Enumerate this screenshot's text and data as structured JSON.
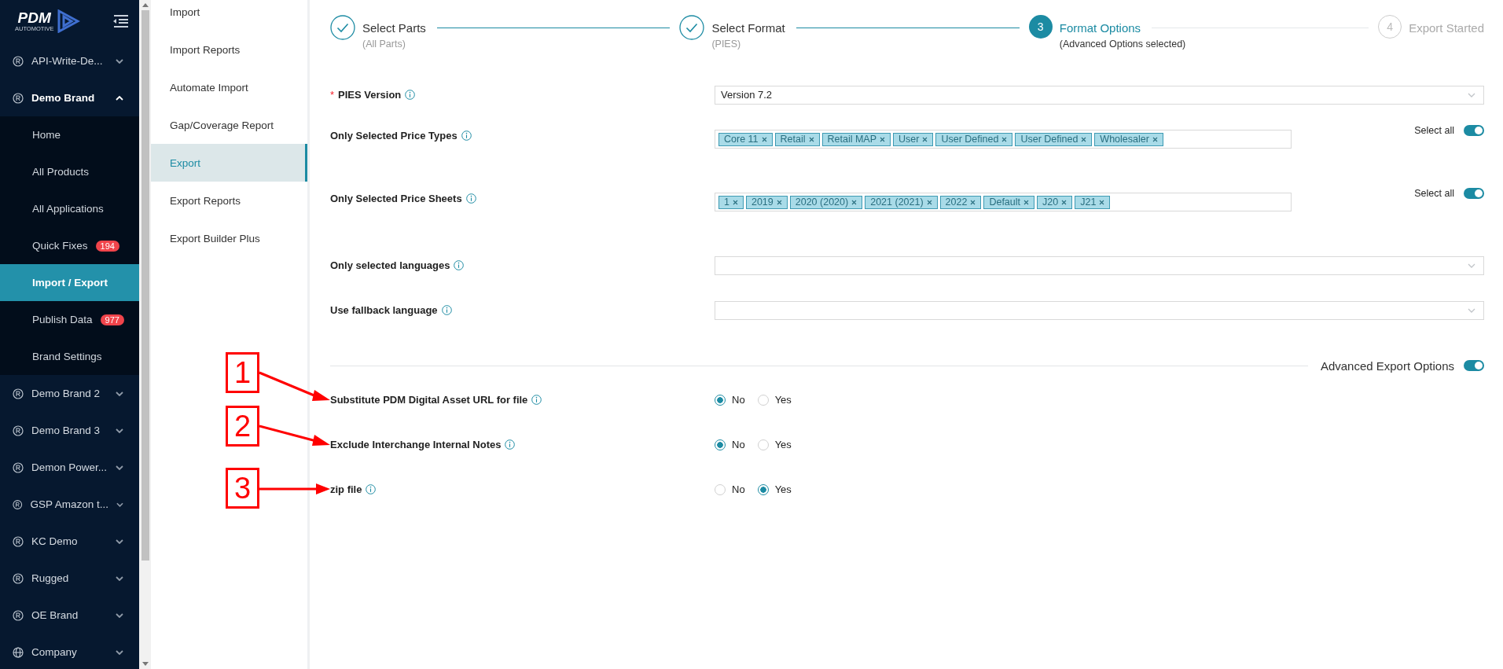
{
  "logo": {
    "name": "PDM",
    "tagline": "AUTOMOTIVE"
  },
  "sidebar": {
    "items": [
      {
        "kind": "brand",
        "label": "API-Write-De...",
        "expanded": false
      },
      {
        "kind": "brand",
        "label": "Demo Brand",
        "expanded": true,
        "children": [
          {
            "label": "Home",
            "selected": false
          },
          {
            "label": "All Products",
            "selected": false
          },
          {
            "label": "All Applications",
            "selected": false
          },
          {
            "label": "Quick Fixes",
            "selected": false,
            "badge": "194"
          },
          {
            "label": "Import / Export",
            "selected": true
          },
          {
            "label": "Publish Data",
            "selected": false,
            "badge": "977"
          },
          {
            "label": "Brand Settings",
            "selected": false
          }
        ]
      },
      {
        "kind": "brand",
        "label": "Demo Brand 2",
        "expanded": false
      },
      {
        "kind": "brand",
        "label": "Demo Brand 3",
        "expanded": false
      },
      {
        "kind": "brand",
        "label": "Demon Power...",
        "expanded": false
      },
      {
        "kind": "brand",
        "label": "GSP Amazon t...",
        "expanded": false
      },
      {
        "kind": "brand",
        "label": "KC Demo",
        "expanded": false
      },
      {
        "kind": "brand",
        "label": "Rugged",
        "expanded": false
      },
      {
        "kind": "brand",
        "label": "OE Brand",
        "expanded": false
      },
      {
        "kind": "company",
        "label": "Company",
        "expanded": false
      }
    ]
  },
  "submenu": [
    {
      "label": "Import",
      "selected": false
    },
    {
      "label": "Import Reports",
      "selected": false
    },
    {
      "label": "Automate Import",
      "selected": false
    },
    {
      "label": "Gap/Coverage Report",
      "selected": false
    },
    {
      "label": "Export",
      "selected": true
    },
    {
      "label": "Export Reports",
      "selected": false
    },
    {
      "label": "Export Builder Plus",
      "selected": false
    }
  ],
  "steps": [
    {
      "title": "Select Parts",
      "description": "(All Parts)",
      "completed": true,
      "current": false
    },
    {
      "title": "Select Format",
      "description": "(PIES)",
      "completed": true,
      "current": false
    },
    {
      "number": "3",
      "title": "Format Options",
      "description": "(Advanced Options selected)",
      "completed": false,
      "current": true
    },
    {
      "number": "4",
      "title": "Export Started",
      "completed": false,
      "current": false
    }
  ],
  "form": [
    {
      "kind": "select",
      "label": "PIES Version",
      "required_mark": "*",
      "value": "Version 7.2"
    },
    {
      "kind": "tags",
      "label": "Only Selected Price Types",
      "tags": [
        "Core 11",
        "Retail",
        "Retail MAP",
        "User",
        "User Defined",
        "User Defined",
        "Wholesaler"
      ],
      "select_all": {
        "label": "Select all",
        "on": true
      }
    },
    {
      "kind": "tags",
      "label": "Only Selected Price Sheets",
      "tags": [
        "1",
        "2019",
        "2020 (2020)",
        "2021 (2021)",
        "2022",
        "Default",
        "J20",
        "J21"
      ],
      "select_all": {
        "label": "Select all",
        "on": true
      }
    },
    {
      "kind": "select",
      "label": "Only selected languages"
    },
    {
      "kind": "select",
      "label": "Use fallback language"
    }
  ],
  "advanced": {
    "label": "Advanced Export Options",
    "on": true,
    "options": [
      {
        "label": "Substitute PDM Digital Asset URL for file",
        "callout": "1",
        "choices": [
          {
            "label": "No",
            "selected": true
          },
          {
            "label": "Yes",
            "selected": false
          }
        ]
      },
      {
        "label": "Exclude Interchange Internal Notes",
        "callout": "2",
        "choices": [
          {
            "label": "No",
            "selected": true
          },
          {
            "label": "Yes",
            "selected": false
          }
        ]
      },
      {
        "label": "zip file",
        "callout": "3",
        "choices": [
          {
            "label": "No",
            "selected": false
          },
          {
            "label": "Yes",
            "selected": true
          }
        ]
      }
    ]
  }
}
